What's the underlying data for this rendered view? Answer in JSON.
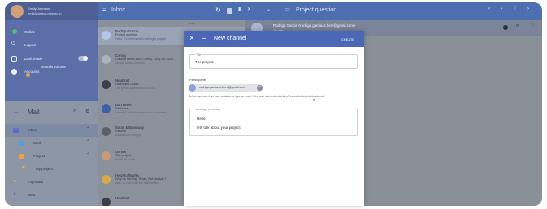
{
  "profile": {
    "name": "Emilly Johnson",
    "email": "emilj@demo.onsetec.io"
  },
  "menu": [
    {
      "label": "Online",
      "icon": "status-dot-icon"
    },
    {
      "label": "Logout",
      "icon": "power-icon"
    },
    {
      "label": "Dark mode",
      "icon": "dark-mode-icon"
    },
    {
      "label": "Accounts",
      "icon": "accounts-icon"
    }
  ],
  "sounds_volume_label": "Sounds volume",
  "sounds_volume_level": 0.18,
  "mail_title": "Mail",
  "mail_nav": [
    {
      "label": "Inbox"
    },
    {
      "label": "Work"
    },
    {
      "label": "Project"
    },
    {
      "label": "My project"
    },
    {
      "label": "Important"
    },
    {
      "label": "Sent"
    }
  ],
  "topbar": {
    "title": "Inbox",
    "subject": "Project question"
  },
  "list": {
    "divider_today": "Today",
    "divider_yesterday": "Yesterday",
    "items": [
      {
        "name": "Rodrigo Garcia",
        "subject": "Project question",
        "preview": "Hello, I'm interested in starting a project!"
      },
      {
        "name": "Comay",
        "subject": "Custom Items from Comay - July 15, 2020",
        "preview": "Unique Matte Collection"
      },
      {
        "name": "NewDraft",
        "subject": "Notes and Drafts",
        "preview": "The great Twitter hack of 2020..."
      },
      {
        "name": "Dan Lewis",
        "subject": "Welcome",
        "preview": "Literally: \"Has this email in your browser\""
      },
      {
        "name": "Sarah & Bhardwaji",
        "subject": "Rescue",
        "preview": "Research in Design..."
      },
      {
        "name": "UI now",
        "subject": "The project",
        "preview": "Email on a deal"
      },
      {
        "name": "HowStuffWorks",
        "subject": "Why do We Say 'Show, But No Ape'?",
        "preview": "Also, do not invite the Saint on the..."
      },
      {
        "name": "NewDraft",
        "subject": "",
        "preview": ""
      }
    ]
  },
  "reader": {
    "from": "Rodrigo Garcia <rodrigo.garcia.is.here@gmail.com>",
    "to": "To: me"
  },
  "dialog": {
    "title": "New channel",
    "create_label": "CREATE",
    "title_legend": "Title",
    "title_value": "The project",
    "participants_label": "Participants",
    "chip_email": "rodrigo.garcia.is.here@gmail.com",
    "chip_initials": "RG",
    "help_text": "Select someone from your contacts, or type an email. If the user does not exist they'll be invited to join this channel.",
    "message_legend": "Message (optional)",
    "message_line1": "Hello,",
    "message_line2": "lets talk about your project."
  },
  "colors": {
    "accent": "#4a68b6",
    "volume_slider": "#f2a348"
  }
}
